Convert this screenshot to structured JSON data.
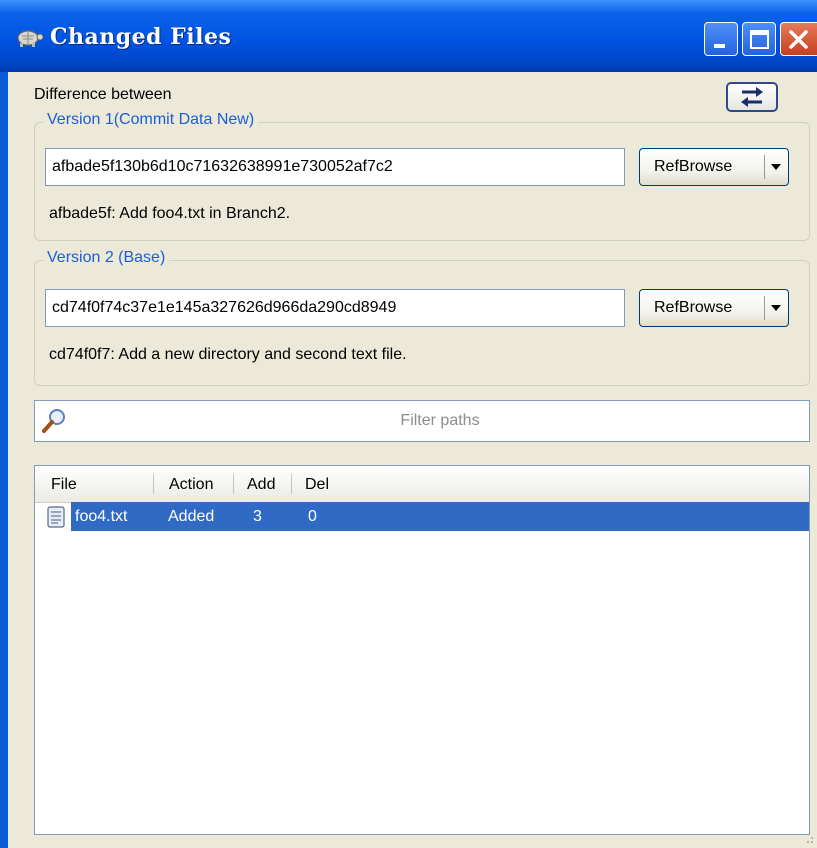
{
  "window": {
    "title": "Changed Files"
  },
  "header": {
    "difference_label": "Difference between"
  },
  "version1": {
    "legend": "Version 1(Commit Data New)",
    "hash": "afbade5f130b6d10c71632638991e730052af7c2",
    "button_label": "RefBrowse",
    "description": "afbade5f: Add foo4.txt in Branch2."
  },
  "version2": {
    "legend": "Version 2 (Base)",
    "hash": "cd74f0f74c37e1e145a327626d966da290cd8949",
    "button_label": "RefBrowse",
    "description": "cd74f0f7: Add a new directory and second text file."
  },
  "filter": {
    "placeholder": "Filter paths"
  },
  "file_list": {
    "columns": [
      "File",
      "Action",
      "Add",
      "Del"
    ],
    "rows": [
      {
        "file": "foo4.txt",
        "action": "Added",
        "add": "3",
        "del": "0",
        "icon": "text-file-icon"
      }
    ]
  },
  "colors": {
    "titlebar": "#0054e3",
    "window_bg": "#ece9d8",
    "legend_text": "#1a5fd8",
    "selection": "#316ac5"
  }
}
